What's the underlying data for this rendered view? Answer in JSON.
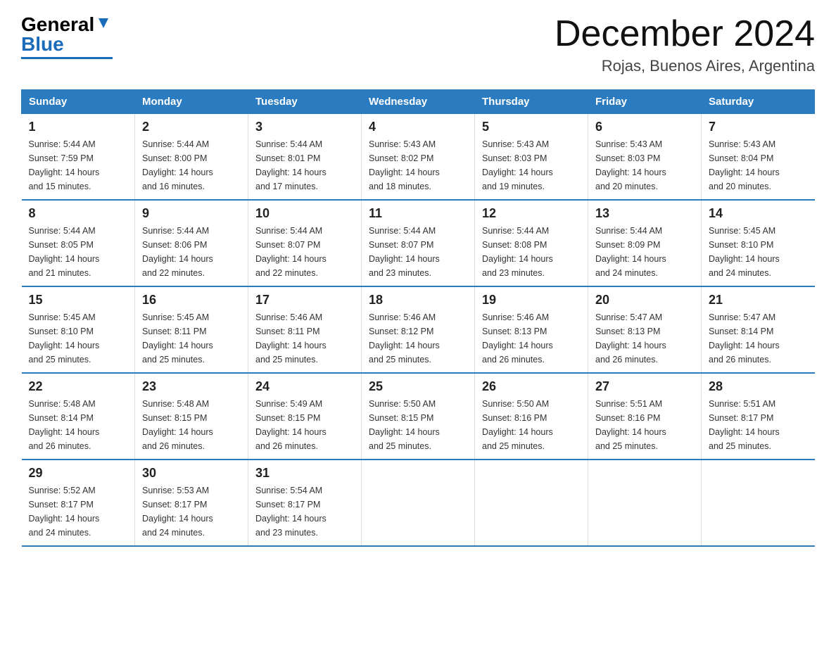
{
  "logo": {
    "general": "General",
    "blue": "Blue"
  },
  "title": "December 2024",
  "subtitle": "Rojas, Buenos Aires, Argentina",
  "days_of_week": [
    "Sunday",
    "Monday",
    "Tuesday",
    "Wednesday",
    "Thursday",
    "Friday",
    "Saturday"
  ],
  "weeks": [
    [
      {
        "day": "1",
        "sunrise": "5:44 AM",
        "sunset": "7:59 PM",
        "daylight": "14 hours and 15 minutes."
      },
      {
        "day": "2",
        "sunrise": "5:44 AM",
        "sunset": "8:00 PM",
        "daylight": "14 hours and 16 minutes."
      },
      {
        "day": "3",
        "sunrise": "5:44 AM",
        "sunset": "8:01 PM",
        "daylight": "14 hours and 17 minutes."
      },
      {
        "day": "4",
        "sunrise": "5:43 AM",
        "sunset": "8:02 PM",
        "daylight": "14 hours and 18 minutes."
      },
      {
        "day": "5",
        "sunrise": "5:43 AM",
        "sunset": "8:03 PM",
        "daylight": "14 hours and 19 minutes."
      },
      {
        "day": "6",
        "sunrise": "5:43 AM",
        "sunset": "8:03 PM",
        "daylight": "14 hours and 20 minutes."
      },
      {
        "day": "7",
        "sunrise": "5:43 AM",
        "sunset": "8:04 PM",
        "daylight": "14 hours and 20 minutes."
      }
    ],
    [
      {
        "day": "8",
        "sunrise": "5:44 AM",
        "sunset": "8:05 PM",
        "daylight": "14 hours and 21 minutes."
      },
      {
        "day": "9",
        "sunrise": "5:44 AM",
        "sunset": "8:06 PM",
        "daylight": "14 hours and 22 minutes."
      },
      {
        "day": "10",
        "sunrise": "5:44 AM",
        "sunset": "8:07 PM",
        "daylight": "14 hours and 22 minutes."
      },
      {
        "day": "11",
        "sunrise": "5:44 AM",
        "sunset": "8:07 PM",
        "daylight": "14 hours and 23 minutes."
      },
      {
        "day": "12",
        "sunrise": "5:44 AM",
        "sunset": "8:08 PM",
        "daylight": "14 hours and 23 minutes."
      },
      {
        "day": "13",
        "sunrise": "5:44 AM",
        "sunset": "8:09 PM",
        "daylight": "14 hours and 24 minutes."
      },
      {
        "day": "14",
        "sunrise": "5:45 AM",
        "sunset": "8:10 PM",
        "daylight": "14 hours and 24 minutes."
      }
    ],
    [
      {
        "day": "15",
        "sunrise": "5:45 AM",
        "sunset": "8:10 PM",
        "daylight": "14 hours and 25 minutes."
      },
      {
        "day": "16",
        "sunrise": "5:45 AM",
        "sunset": "8:11 PM",
        "daylight": "14 hours and 25 minutes."
      },
      {
        "day": "17",
        "sunrise": "5:46 AM",
        "sunset": "8:11 PM",
        "daylight": "14 hours and 25 minutes."
      },
      {
        "day": "18",
        "sunrise": "5:46 AM",
        "sunset": "8:12 PM",
        "daylight": "14 hours and 25 minutes."
      },
      {
        "day": "19",
        "sunrise": "5:46 AM",
        "sunset": "8:13 PM",
        "daylight": "14 hours and 26 minutes."
      },
      {
        "day": "20",
        "sunrise": "5:47 AM",
        "sunset": "8:13 PM",
        "daylight": "14 hours and 26 minutes."
      },
      {
        "day": "21",
        "sunrise": "5:47 AM",
        "sunset": "8:14 PM",
        "daylight": "14 hours and 26 minutes."
      }
    ],
    [
      {
        "day": "22",
        "sunrise": "5:48 AM",
        "sunset": "8:14 PM",
        "daylight": "14 hours and 26 minutes."
      },
      {
        "day": "23",
        "sunrise": "5:48 AM",
        "sunset": "8:15 PM",
        "daylight": "14 hours and 26 minutes."
      },
      {
        "day": "24",
        "sunrise": "5:49 AM",
        "sunset": "8:15 PM",
        "daylight": "14 hours and 26 minutes."
      },
      {
        "day": "25",
        "sunrise": "5:50 AM",
        "sunset": "8:15 PM",
        "daylight": "14 hours and 25 minutes."
      },
      {
        "day": "26",
        "sunrise": "5:50 AM",
        "sunset": "8:16 PM",
        "daylight": "14 hours and 25 minutes."
      },
      {
        "day": "27",
        "sunrise": "5:51 AM",
        "sunset": "8:16 PM",
        "daylight": "14 hours and 25 minutes."
      },
      {
        "day": "28",
        "sunrise": "5:51 AM",
        "sunset": "8:17 PM",
        "daylight": "14 hours and 25 minutes."
      }
    ],
    [
      {
        "day": "29",
        "sunrise": "5:52 AM",
        "sunset": "8:17 PM",
        "daylight": "14 hours and 24 minutes."
      },
      {
        "day": "30",
        "sunrise": "5:53 AM",
        "sunset": "8:17 PM",
        "daylight": "14 hours and 24 minutes."
      },
      {
        "day": "31",
        "sunrise": "5:54 AM",
        "sunset": "8:17 PM",
        "daylight": "14 hours and 23 minutes."
      },
      null,
      null,
      null,
      null
    ]
  ],
  "labels": {
    "sunrise": "Sunrise:",
    "sunset": "Sunset:",
    "daylight": "Daylight:"
  }
}
